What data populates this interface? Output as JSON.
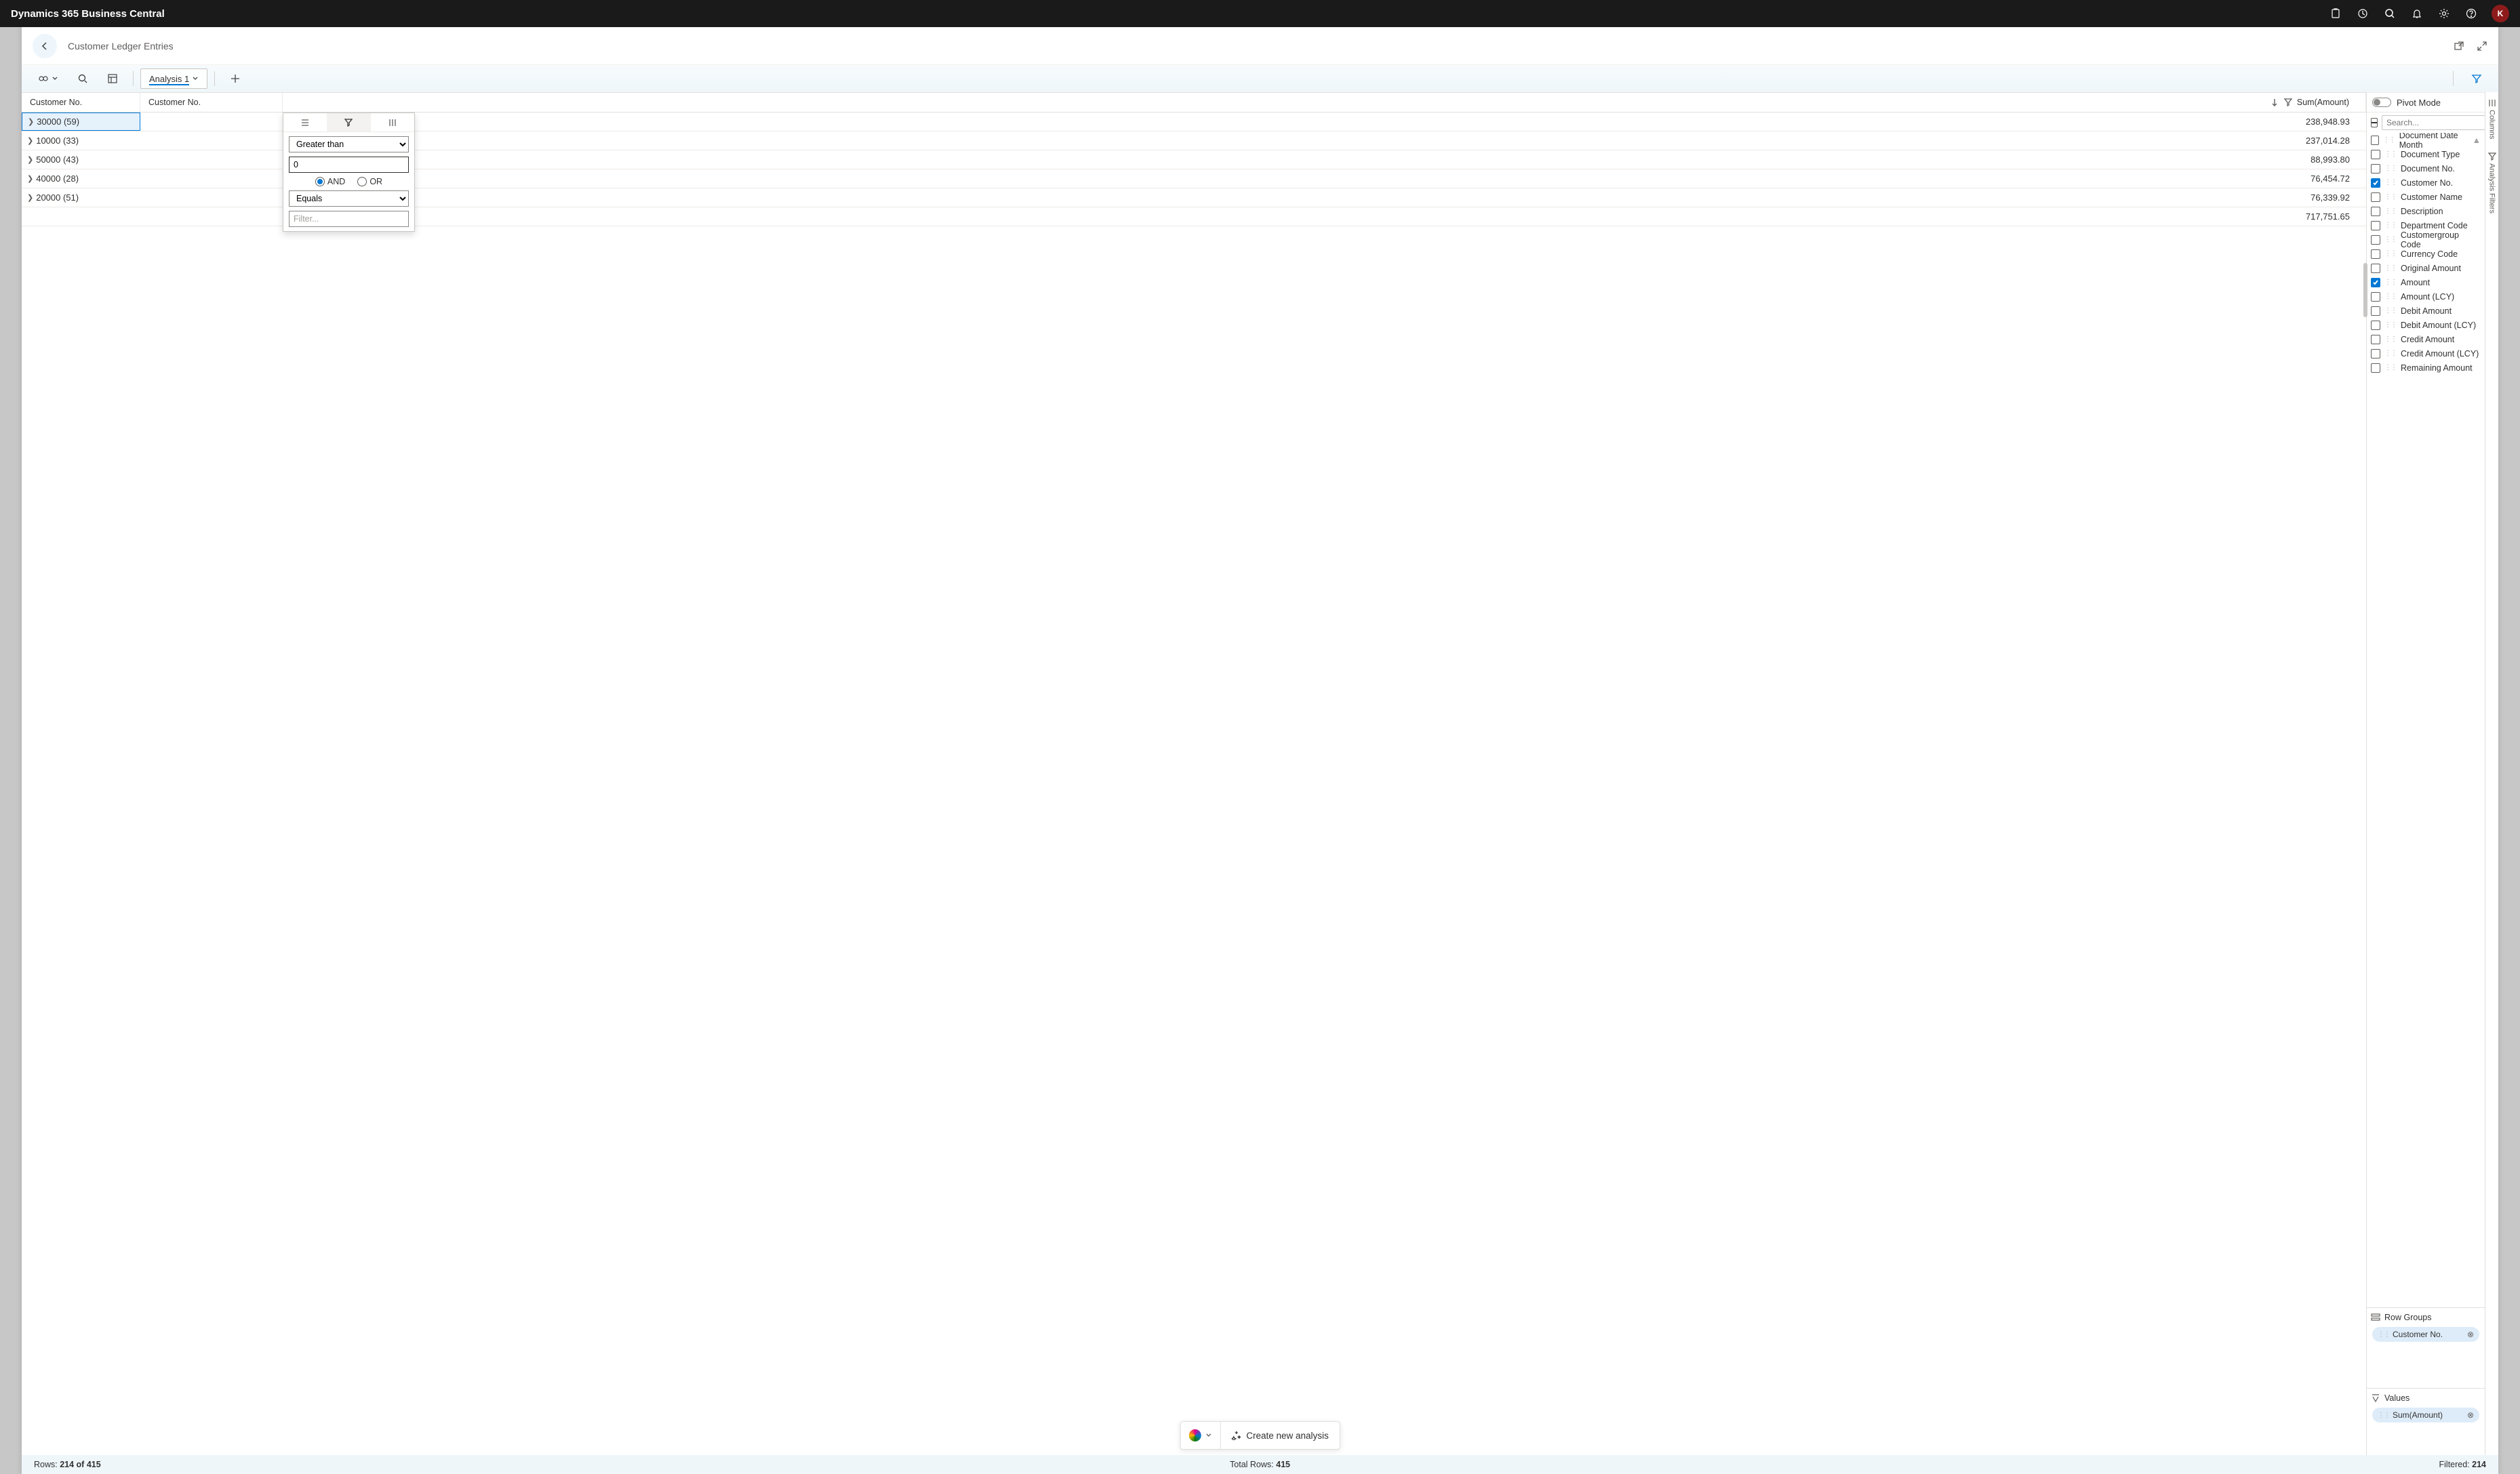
{
  "topbar": {
    "title": "Dynamics 365 Business Central",
    "avatar_initial": "K"
  },
  "page": {
    "title": "Customer Ledger Entries"
  },
  "toolbar": {
    "tab_labels": [
      "Analysis 1"
    ],
    "active_tab": 0
  },
  "columns": {
    "group_by": "Customer No.",
    "pivot_col": "Customer No.",
    "value_col": "Sum(Amount)"
  },
  "filter_popup": {
    "op1": "Greater than",
    "val1": "0",
    "logic_and": "AND",
    "logic_or": "OR",
    "op2": "Equals",
    "val2_placeholder": "Filter..."
  },
  "rows": [
    {
      "group": "30000",
      "count": 59,
      "amount": "238,948.93",
      "selected": true
    },
    {
      "group": "10000",
      "count": 33,
      "amount": "237,014.28"
    },
    {
      "group": "50000",
      "count": 43,
      "amount": "88,993.80"
    },
    {
      "group": "40000",
      "count": 28,
      "amount": "76,454.72"
    },
    {
      "group": "20000",
      "count": 51,
      "amount": "76,339.92"
    }
  ],
  "total_amount": "717,751.65",
  "panel": {
    "pivot_label": "Pivot Mode",
    "search_placeholder": "Search...",
    "fields": [
      {
        "label": "Document Date Month",
        "checked": false
      },
      {
        "label": "Document Type",
        "checked": false
      },
      {
        "label": "Document No.",
        "checked": false
      },
      {
        "label": "Customer No.",
        "checked": true
      },
      {
        "label": "Customer Name",
        "checked": false
      },
      {
        "label": "Description",
        "checked": false
      },
      {
        "label": "Department Code",
        "checked": false
      },
      {
        "label": "Customergroup Code",
        "checked": false
      },
      {
        "label": "Currency Code",
        "checked": false
      },
      {
        "label": "Original Amount",
        "checked": false
      },
      {
        "label": "Amount",
        "checked": true
      },
      {
        "label": "Amount (LCY)",
        "checked": false
      },
      {
        "label": "Debit Amount",
        "checked": false
      },
      {
        "label": "Debit Amount (LCY)",
        "checked": false
      },
      {
        "label": "Credit Amount",
        "checked": false
      },
      {
        "label": "Credit Amount (LCY)",
        "checked": false
      },
      {
        "label": "Remaining Amount",
        "checked": false
      }
    ],
    "row_groups_title": "Row Groups",
    "row_groups_chip": "Customer No.",
    "values_title": "Values",
    "values_chip": "Sum(Amount)"
  },
  "rail": {
    "columns_tab": "Columns",
    "filters_tab": "Analysis Filters"
  },
  "float": {
    "create_label": "Create new analysis"
  },
  "status": {
    "rows_label": "Rows:",
    "rows_value": "214 of 415",
    "total_label": "Total Rows:",
    "total_value": "415",
    "filtered_label": "Filtered:",
    "filtered_value": "214"
  }
}
